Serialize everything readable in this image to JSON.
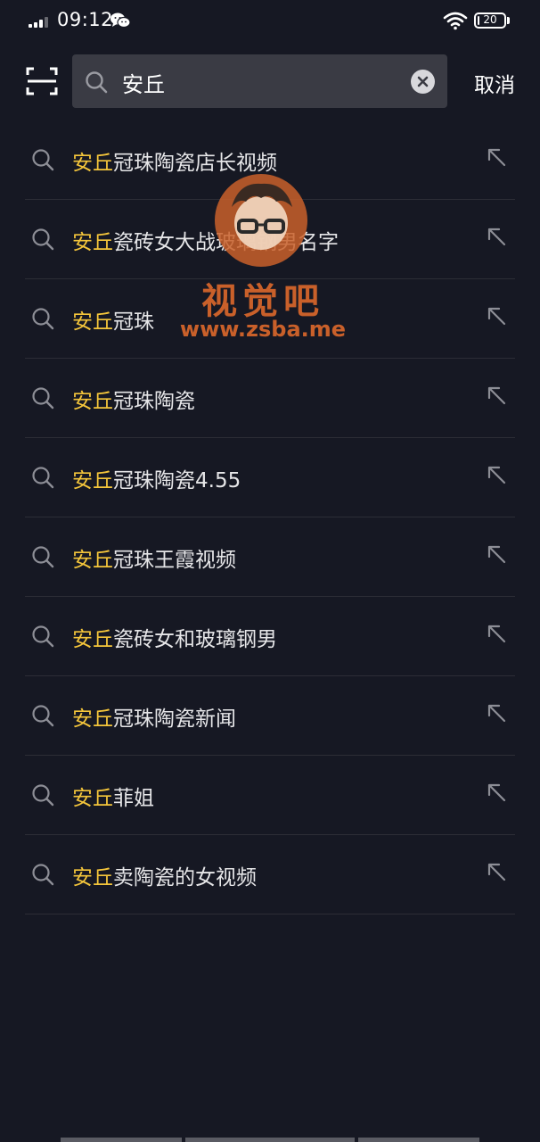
{
  "status_bar": {
    "time": "09:12",
    "battery": "20",
    "battery_level": 0.2,
    "icons": [
      "signal-icon",
      "wechat-icon",
      "wifi-icon",
      "battery-icon"
    ]
  },
  "search": {
    "query": "安丘",
    "cancel_label": "取消",
    "icons": [
      "scan-icon",
      "search-icon",
      "clear-icon"
    ]
  },
  "suggestions": [
    {
      "highlight": "安丘",
      "rest": "冠珠陶瓷店长视频"
    },
    {
      "highlight": "安丘",
      "rest": "瓷砖女大战玻璃钢男名字"
    },
    {
      "highlight": "安丘",
      "rest": "冠珠"
    },
    {
      "highlight": "安丘",
      "rest": "冠珠陶瓷"
    },
    {
      "highlight": "安丘",
      "rest": "冠珠陶瓷4.55"
    },
    {
      "highlight": "安丘",
      "rest": "冠珠王霞视频"
    },
    {
      "highlight": "安丘",
      "rest": "瓷砖女和玻璃钢男"
    },
    {
      "highlight": "安丘",
      "rest": "冠珠陶瓷新闻"
    },
    {
      "highlight": "安丘",
      "rest": "菲姐"
    },
    {
      "highlight": "安丘",
      "rest": "卖陶瓷的女视频"
    }
  ],
  "watermark": {
    "title": "视觉吧",
    "url": "www.zsba.me"
  },
  "colors": {
    "background": "#161823",
    "highlight": "#f5c63b",
    "search_box": "#3a3b44",
    "divider": "#2c2d36",
    "watermark": "#c9602a"
  }
}
